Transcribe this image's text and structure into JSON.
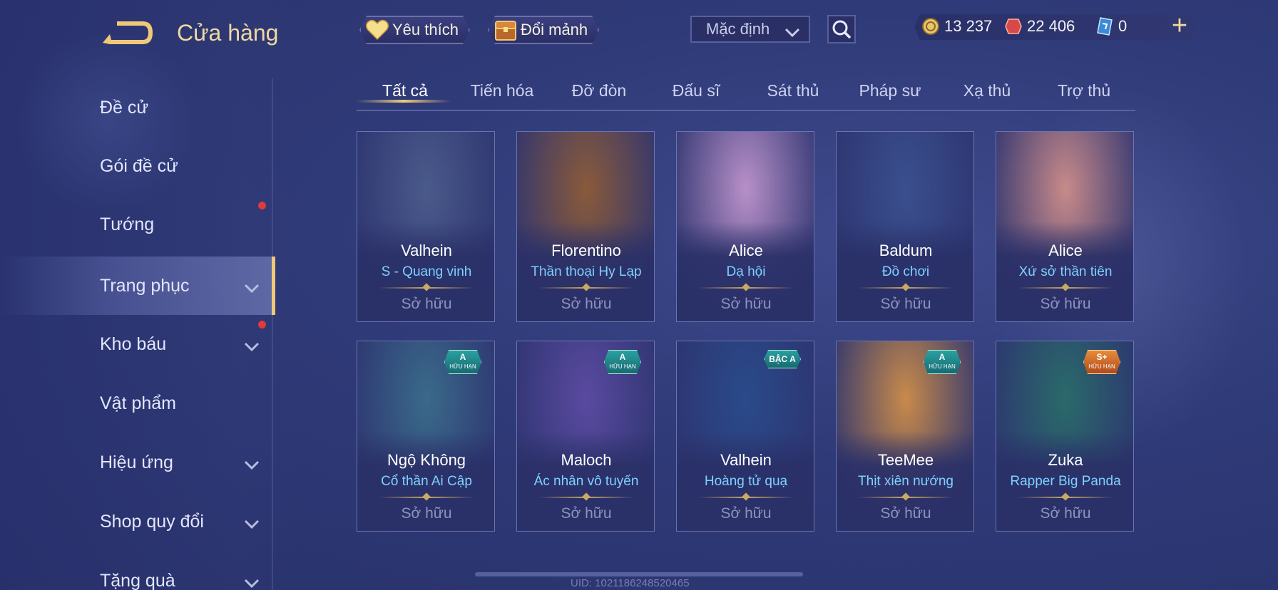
{
  "header": {
    "title": "Cửa hàng",
    "favorite_label": "Yêu thích",
    "exchange_label": "Đổi mảnh",
    "sort_value": "Mặc định"
  },
  "currencies": {
    "gold": "13 237",
    "voucher": "22 406",
    "card": "0"
  },
  "sidebar": {
    "items": [
      {
        "label": "Đề cử"
      },
      {
        "label": "Gói đề cử"
      },
      {
        "label": "Tướng"
      },
      {
        "label": "Trang phục"
      },
      {
        "label": "Kho báu"
      },
      {
        "label": "Vật phẩm"
      },
      {
        "label": "Hiệu ứng"
      },
      {
        "label": "Shop quy đổi"
      },
      {
        "label": "Tặng quà"
      }
    ]
  },
  "tabs": [
    "Tất cả",
    "Tiến hóa",
    "Đỡ đòn",
    "Đấu sĩ",
    "Sát thủ",
    "Pháp sư",
    "Xạ thủ",
    "Trợ thủ"
  ],
  "cards": [
    {
      "hero": "Valhein",
      "skin": "S - Quang vinh",
      "status": "Sở hữu",
      "color": "#4a5a8a"
    },
    {
      "hero": "Florentino",
      "skin": "Thần thoại Hy Lạp",
      "status": "Sở hữu",
      "color": "#8a5a3a"
    },
    {
      "hero": "Alice",
      "skin": "Dạ hội",
      "status": "Sở hữu",
      "color": "#b890c8"
    },
    {
      "hero": "Baldum",
      "skin": "Đồ chơi",
      "status": "Sở hữu",
      "color": "#3a4f8e"
    },
    {
      "hero": "Alice",
      "skin": "Xứ sở thần tiên",
      "status": "Sở hữu",
      "color": "#c88a8a"
    },
    {
      "hero": "Ngộ Không",
      "skin": "Cổ thần Ai Cập",
      "status": "Sở hữu",
      "color": "#3a6a8a",
      "badge_top": "A",
      "badge_bottom": "HỮU HẠN"
    },
    {
      "hero": "Maloch",
      "skin": "Ác nhân vô tuyến",
      "status": "Sở hữu",
      "color": "#5a4aa0",
      "badge_top": "A",
      "badge_bottom": "HỮU HẠN"
    },
    {
      "hero": "Valhein",
      "skin": "Hoàng tử quạ",
      "status": "Sở hữu",
      "color": "#2a4a8a",
      "badge_top": "BẬC A"
    },
    {
      "hero": "TeeMee",
      "skin": "Thịt xiên nướng",
      "status": "Sở hữu",
      "color": "#c88a4a",
      "badge_top": "A",
      "badge_bottom": "HỮU HẠN"
    },
    {
      "hero": "Zuka",
      "skin": "Rapper Big Panda",
      "status": "Sở hữu",
      "color": "#2a6a6a",
      "badge_top": "S+",
      "badge_bottom": "HỮU HẠN",
      "badge_gold": true
    }
  ],
  "footer": {
    "uid": "UID: 1021186248520465"
  },
  "colors": {
    "accent_gold": "#f0c978",
    "skin_name_blue": "#7fd0ff",
    "notification_red": "#e03a3a"
  },
  "icons": {
    "back": "back-arrow-icon",
    "favorite": "heart-icon",
    "exchange": "treasure-chest-icon",
    "search": "search-icon",
    "gold": "gold-coin-icon",
    "voucher": "voucher-gem-icon",
    "card": "card-icon",
    "add": "plus-icon",
    "expand": "chevron-down-icon"
  }
}
